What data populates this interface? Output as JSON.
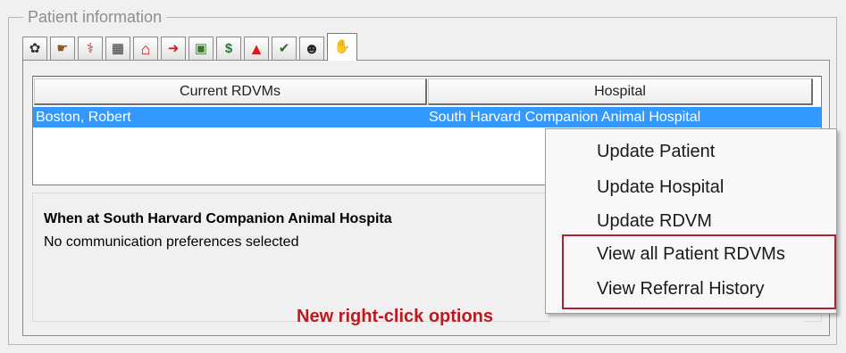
{
  "group": {
    "title": "Patient information"
  },
  "toolbar": {
    "tabs": [
      {
        "icon": "paw-print-icon",
        "glyph": "✿",
        "color": "#333333"
      },
      {
        "icon": "hand-pointer-icon",
        "glyph": "☛",
        "color": "#8a5a1a"
      },
      {
        "icon": "medical-cross-icon",
        "glyph": "⚕",
        "color": "#c0201c"
      },
      {
        "icon": "vaccine-chart-icon",
        "glyph": "▦",
        "color": "#333333"
      },
      {
        "icon": "home-icon",
        "glyph": "⌂",
        "color": "#d01010"
      },
      {
        "icon": "exit-door-icon",
        "glyph": "➜",
        "color": "#d02020"
      },
      {
        "icon": "folder-document-icon",
        "glyph": "▣",
        "color": "#3a7a2a"
      },
      {
        "icon": "billing-icon",
        "glyph": "$",
        "color": "#2a7a3a"
      },
      {
        "icon": "alert-warning-icon",
        "glyph": "▲",
        "color": "#e01818"
      },
      {
        "icon": "checklist-icon",
        "glyph": "✔",
        "color": "#2a6a2a"
      },
      {
        "icon": "person-contact-icon",
        "glyph": "☻",
        "color": "#222222"
      },
      {
        "icon": "handshake-icon",
        "glyph": "✋",
        "color": "#555555"
      }
    ]
  },
  "listview": {
    "columns": [
      "Current RDVMs",
      "Hospital"
    ],
    "rows": [
      {
        "rdvm": "Boston, Robert",
        "hospital": "South Harvard Companion Animal Hospital"
      }
    ]
  },
  "comm": {
    "title": "When at South Harvard Companion Animal Hospita",
    "subtitle": "No communication preferences selected"
  },
  "context_menu": {
    "items": [
      "Update Patient",
      "Update Hospital",
      "Update RDVM",
      "View all Patient RDVMs",
      "View Referral History"
    ]
  },
  "callout": {
    "text": "New right-click options",
    "color": "#c0181f"
  }
}
